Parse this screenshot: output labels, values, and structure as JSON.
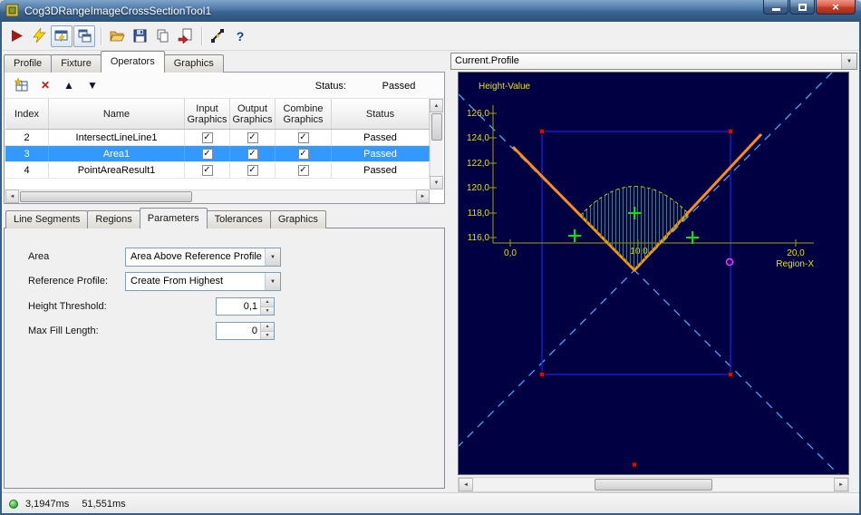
{
  "window": {
    "title": "Cog3DRangeImageCrossSectionTool1"
  },
  "icons": {
    "check": "✓",
    "delete": "✕",
    "up_arrow": "▲",
    "down_arrow": "▼",
    "help": "?",
    "combo_arrow": "▼",
    "scroll_up": "▲",
    "scroll_down": "▼",
    "scroll_left": "◄",
    "scroll_right": "►",
    "close": "×"
  },
  "tabs": {
    "items": [
      "Profile",
      "Fixture",
      "Operators",
      "Graphics"
    ],
    "active": "Operators"
  },
  "operators": {
    "status_label": "Status:",
    "status_value": "Passed",
    "table": {
      "columns": [
        "Index",
        "Name",
        "Input Graphics",
        "Output Graphics",
        "Combine Graphics",
        "Status"
      ],
      "rows": [
        {
          "index": "2",
          "name": "IntersectLineLine1",
          "input_graphics": true,
          "output_graphics": true,
          "combine_graphics": true,
          "status": "Passed"
        },
        {
          "index": "3",
          "name": "Area1",
          "input_graphics": true,
          "output_graphics": true,
          "combine_graphics": true,
          "status": "Passed",
          "selected": true
        },
        {
          "index": "4",
          "name": "PointAreaResult1",
          "input_graphics": true,
          "output_graphics": true,
          "combine_graphics": true,
          "status": "Passed"
        }
      ]
    }
  },
  "subtabs": {
    "items": [
      "Line Segments",
      "Regions",
      "Parameters",
      "Tolerances",
      "Graphics"
    ],
    "active": "Parameters"
  },
  "parameters": {
    "area_label": "Area",
    "area_value": "Area Above Reference Profile",
    "reference_label": "Reference Profile:",
    "reference_value": "Create From Highest",
    "height_label": "Height Threshold:",
    "height_value": "0,1",
    "maxfill_label": "Max Fill Length:",
    "maxfill_value": "0"
  },
  "graph": {
    "header": "Current.Profile",
    "ylabel": "Height-Value",
    "xlabel": "Region-X",
    "y_ticks": [
      "126,0",
      "124,0",
      "122,0",
      "120,0",
      "118,0",
      "116,0"
    ],
    "x_ticks": [
      "0,0",
      "10,0",
      "20,0"
    ],
    "colors": {
      "background": "#000042",
      "profile_line": "#ff8c1a",
      "region_box": "#1818c8",
      "crosshair": "#4da6ff",
      "area_hatch": "#00b400",
      "axis_label": "#e8e000",
      "marker_cross": "#00e800",
      "marker_corner": "#c41414",
      "marker_circle": "#ff30ff"
    }
  },
  "statusbar": {
    "time1": "3,1947ms",
    "time2": "51,551ms"
  }
}
